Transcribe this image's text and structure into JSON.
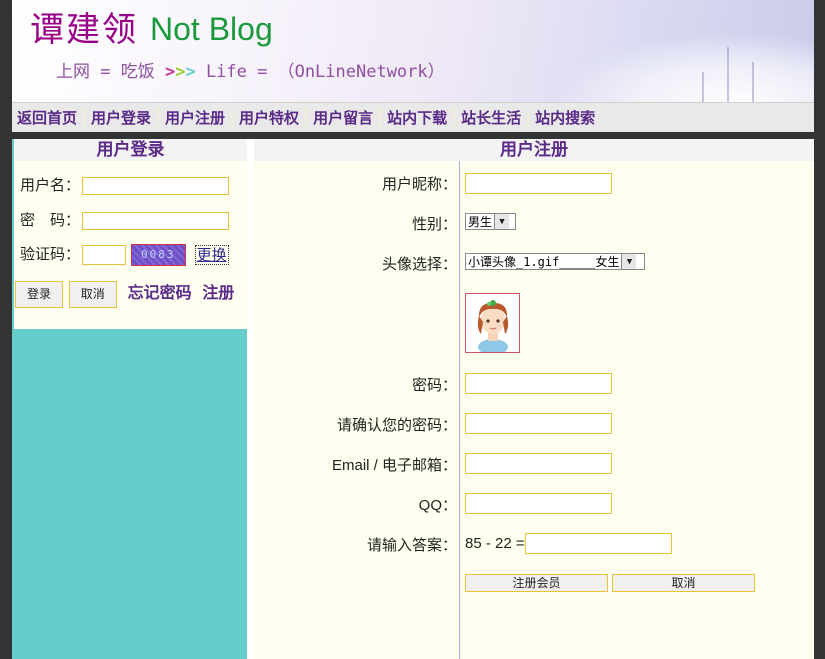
{
  "header": {
    "site_name": "谭建领",
    "site_sub": "Not Blog",
    "tagline_left": "上网 = 吃饭 ",
    "tagline_arrows": [
      ">",
      ">",
      ">"
    ],
    "tagline_right": " Life = （OnLineNetwork）",
    "arrow_colors": [
      "#cc3399",
      "#99cc33",
      "#66cccc"
    ]
  },
  "nav": {
    "items": [
      "返回首页",
      "用户登录",
      "用户注册",
      "用户特权",
      "用户留言",
      "站内下载",
      "站长生活",
      "站内搜索"
    ]
  },
  "login": {
    "title": "用户登录",
    "username_label": "用户名：",
    "password_label": "密　码：",
    "captcha_label": "验证码：",
    "captcha_text": "0083",
    "refresh": "更换",
    "login_button": "登录",
    "cancel_button": "取消",
    "forgot": "忘记密码",
    "register": "注册"
  },
  "register": {
    "title": "用户注册",
    "nickname_label": "用户昵称：",
    "gender_label": "性别：",
    "gender_value": "男生",
    "avatar_label": "头像选择：",
    "avatar_value": "小谭头像_1.gif_____女生",
    "password_label": "密码：",
    "confirm_label": "请确认您的密码：",
    "email_label": "Email / 电子邮箱：",
    "qq_label": "QQ：",
    "answer_label": "请输入答案：",
    "question": "85 - 22 =",
    "submit_button": "注册会员",
    "cancel_button": "取消"
  },
  "colors": {
    "accent": "#5a2a88",
    "left_bg": "#66cccc",
    "panel_bg": "#fffff0",
    "input_border": "#e8c23c"
  }
}
